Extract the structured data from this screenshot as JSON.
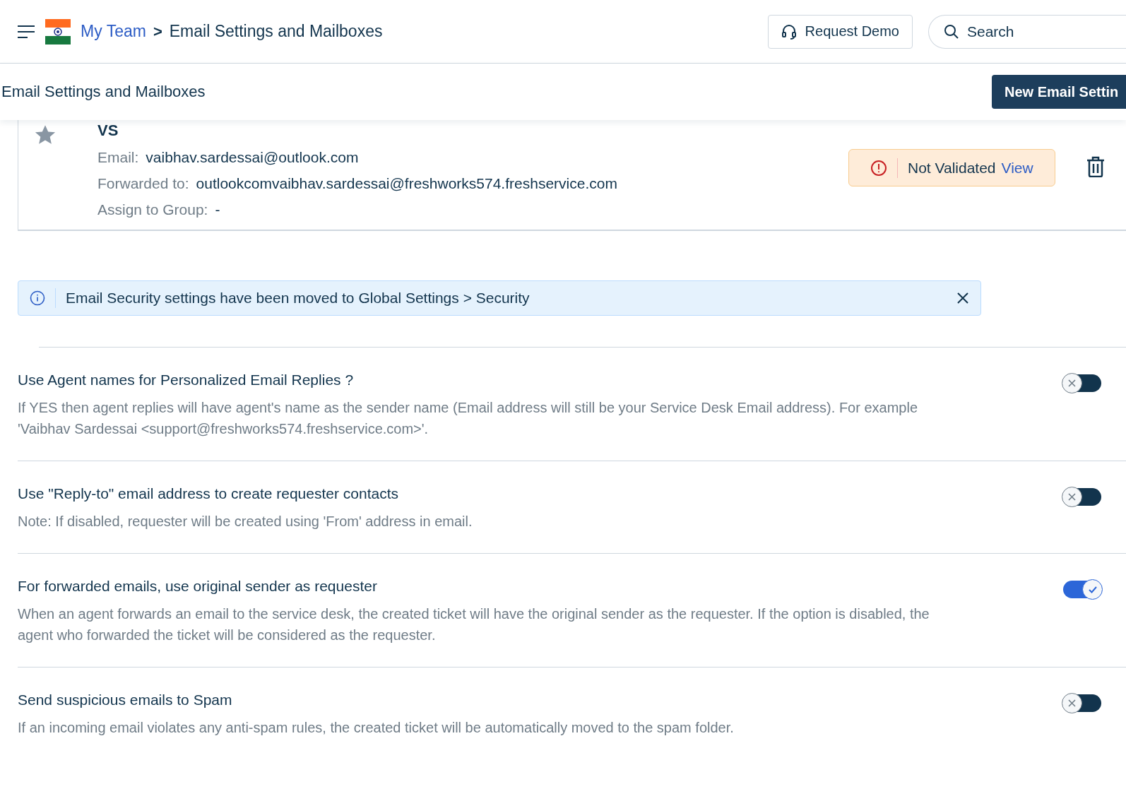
{
  "header": {
    "breadcrumb_parent": "My Team",
    "breadcrumb_separator": ">",
    "title": "Email Settings and Mailboxes",
    "request_demo": "Request Demo",
    "search": {
      "placeholder": "Search"
    }
  },
  "page_header": {
    "title": "Email Settings and Mailboxes",
    "new_button": "New Email Settin"
  },
  "mailbox": {
    "name": "VS",
    "starred": false,
    "fields": [
      {
        "label": "Email:",
        "value": "vaibhav.sardessai@outlook.com"
      },
      {
        "label": "Forwarded to:",
        "value": "outlookcomvaibhav.sardessai@freshworks574.freshservice.com"
      },
      {
        "label": "Assign to Group:",
        "value": "-"
      }
    ],
    "status": {
      "text": "Not Validated",
      "link": "View"
    }
  },
  "info_banner": {
    "text": "Email Security settings have been moved to Global Settings > Security"
  },
  "settings": [
    {
      "title": "Use Agent names for Personalized Email Replies ?",
      "description": "If YES then agent replies will have agent's name as the sender name (Email address will still be your Service Desk Email address). For example 'Vaibhav Sardessai <support@freshworks574.freshservice.com>'.",
      "on": false
    },
    {
      "title": "Use \"Reply-to\" email address to create requester contacts",
      "description": "Note: If disabled, requester will be created using 'From' address in email.",
      "on": false
    },
    {
      "title": "For forwarded emails, use original sender as requester",
      "description": "When an agent forwards an email to the service desk, the created ticket will have the original sender as the requester. If the option is disabled, the agent who forwarded the ticket will be considered as the requester.",
      "on": true
    },
    {
      "title": "Send suspicious emails to Spam",
      "description": "If an incoming email violates any anti-spam rules, the created ticket will be automatically moved to the spam folder.",
      "on": false
    }
  ]
}
